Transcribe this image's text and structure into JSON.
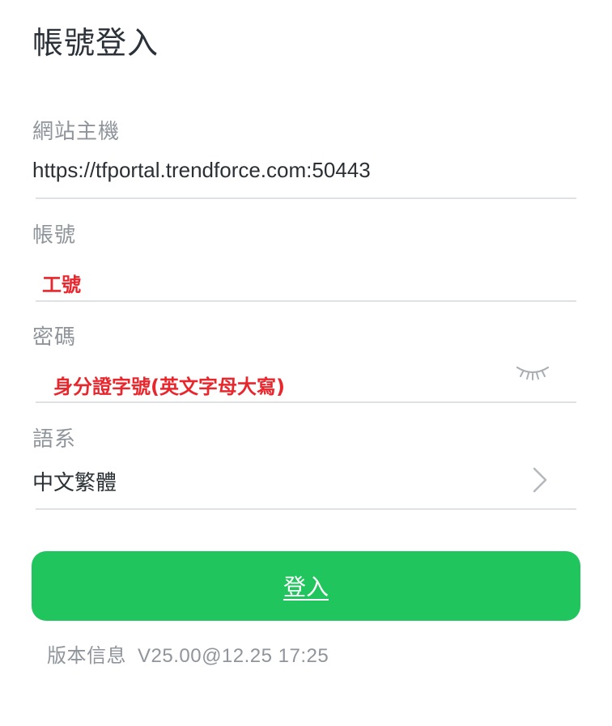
{
  "header": {
    "title": "帳號登入"
  },
  "host": {
    "label": "網站主機",
    "value": "https://tfportal.trendforce.com:50443"
  },
  "account": {
    "label": "帳號",
    "hint": "工號"
  },
  "password": {
    "label": "密碼",
    "hint": "身分證字號(英文字母大寫)",
    "toggle_icon": "eye-closed-icon"
  },
  "language": {
    "label": "語系",
    "value": "中文繁體",
    "chevron_icon": "chevron-right-icon"
  },
  "login_button": {
    "label": "登入"
  },
  "version": {
    "label": "版本信息",
    "value": "V25.00@12.25 17:25"
  },
  "colors": {
    "accent": "#21c55d",
    "annotation": "#e8262c",
    "label": "#8f959a",
    "text": "#2b3035"
  }
}
